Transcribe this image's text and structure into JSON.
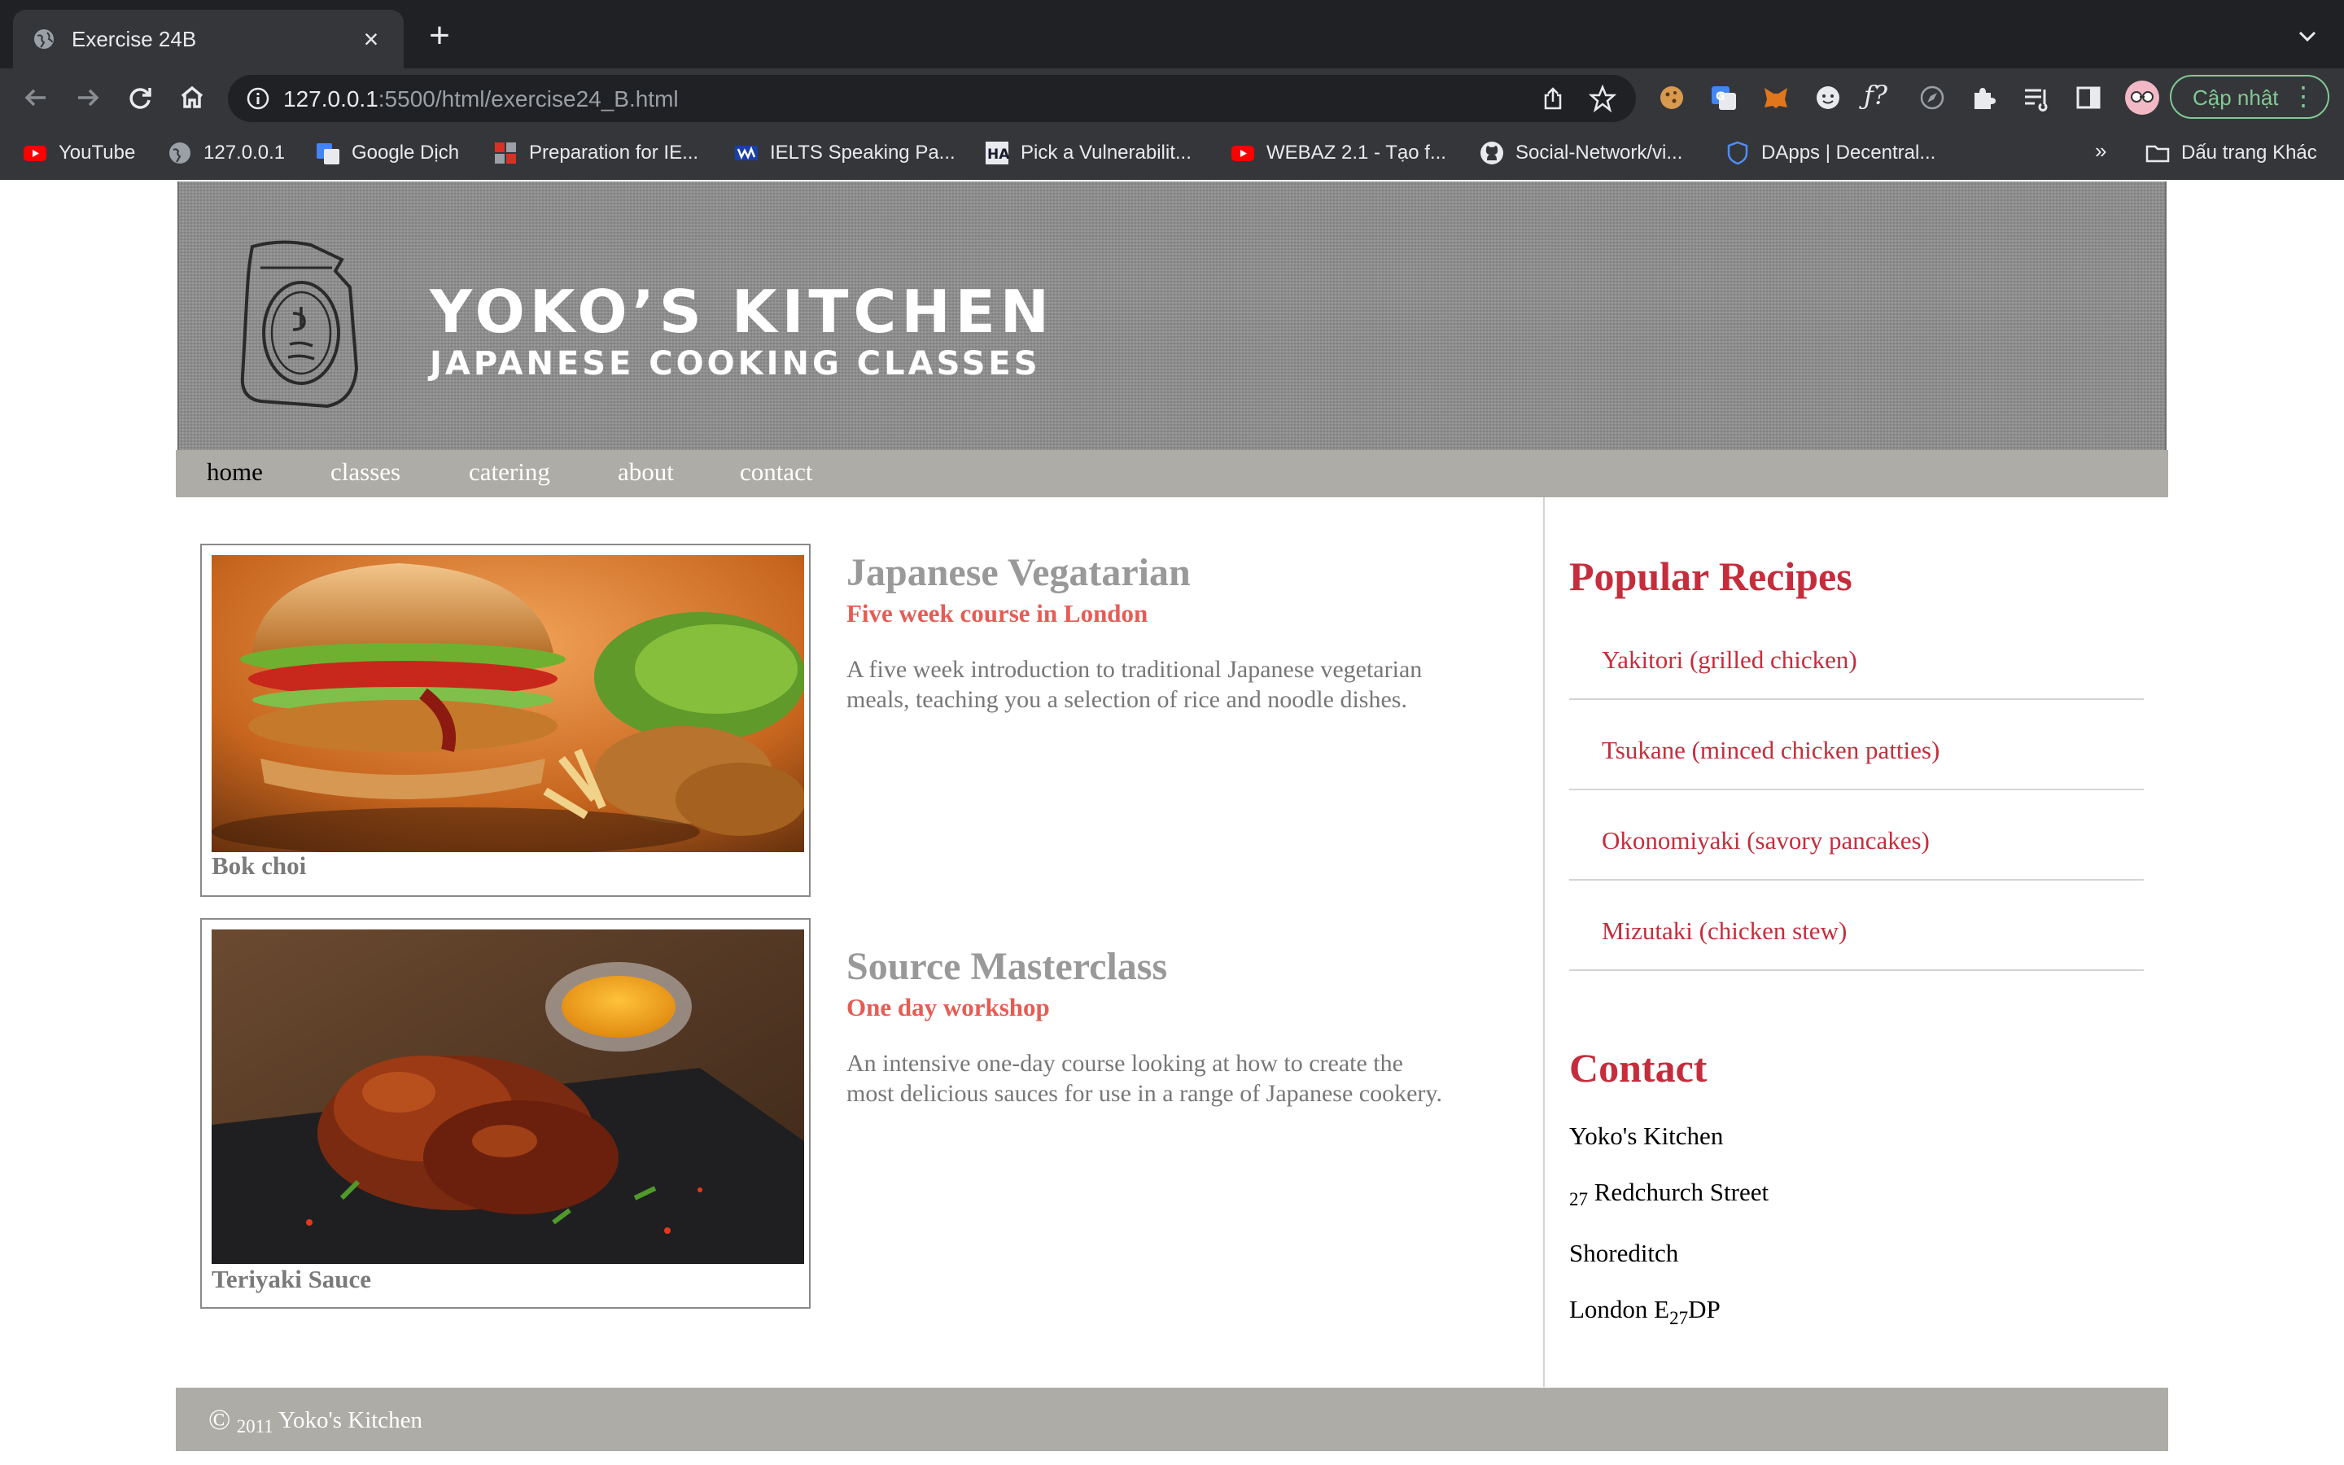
{
  "browser": {
    "tab_title": "Exercise 24B",
    "new_tab_label": "+",
    "url_host": "127.0.0.1",
    "url_rest": ":5500/html/exercise24_B.html",
    "update_label": "Cập nhật",
    "bookmarks": [
      {
        "label": "YouTube",
        "icon": "youtube-icon"
      },
      {
        "label": "127.0.0.1",
        "icon": "globe-icon"
      },
      {
        "label": "Google Dịch",
        "icon": "google-translate-icon"
      },
      {
        "label": "Preparation for IE...",
        "icon": "grid-icon"
      },
      {
        "label": "IELTS Speaking Pa...",
        "icon": "ielts-icon"
      },
      {
        "label": "Pick a Vulnerabilit...",
        "icon": "ha-icon"
      },
      {
        "label": "WEBAZ 2.1 - Tạo f...",
        "icon": "youtube-icon"
      },
      {
        "label": "Social-Network/vi...",
        "icon": "github-icon"
      },
      {
        "label": "DApps | Decentral...",
        "icon": "shield-icon"
      }
    ],
    "bookmarks_more": "»",
    "other_bookmarks": "Dấu trang Khác"
  },
  "site": {
    "brand_line1": "YOKO’S KITCHEN",
    "brand_line2": "JAPANESE COOKING CLASSES",
    "nav": [
      "home",
      "classes",
      "catering",
      "about",
      "contact"
    ],
    "courses": [
      {
        "caption": "Bok choi",
        "title": "Japanese Vegatarian",
        "subtitle": "Five week course in London",
        "description": "A five week introduction to traditional Japanese vegetarian meals, teaching you a selection of rice and noodle dishes."
      },
      {
        "caption": "Teriyaki Sauce",
        "title": "Source Masterclass",
        "subtitle": "One day workshop",
        "description": "An intensive one-day course looking at how to create the most delicious sauces for use in a range of Japanese cookery."
      }
    ],
    "recipes_heading": "Popular Recipes",
    "recipes": [
      "Yakitori (grilled chicken)",
      "Tsukane (minced chicken patties)",
      "Okonomiyaki (savory pancakes)",
      "Mizutaki (chicken stew)"
    ],
    "contact_heading": "Contact",
    "contact": {
      "name": "Yoko's Kitchen",
      "street_num": "27",
      "street": "Redchurch Street",
      "district": "Shoreditch",
      "city_a": "London E",
      "city_b": "27",
      "city_c": "DP"
    },
    "footer": {
      "symbol": "©",
      "year": "2011",
      "name": "Yoko's Kitchen"
    }
  },
  "colors": {
    "accent_red": "#c52d3c",
    "subtitle_red": "#e65c55",
    "nav_gray": "#adaca7"
  }
}
